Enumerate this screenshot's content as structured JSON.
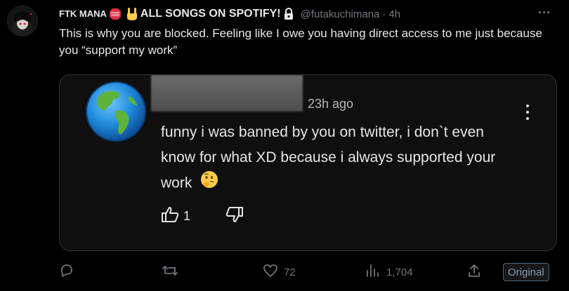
{
  "post": {
    "display_name": "FTK MANA",
    "display_name_suffix": "ALL SONGS ON SPOTIFY!",
    "handle": "@futakuchimana",
    "separator": "·",
    "time": "4h",
    "text": "This is why you are blocked. Feeling like I owe you having direct access to me just because you “support my work”"
  },
  "embedded_comment": {
    "time": "23h ago",
    "text": "funny i was banned by you on twitter, i don`t even know for what XD because i always supported your work",
    "like_count": "1"
  },
  "actions": {
    "replies": "",
    "reposts": "",
    "likes": "72",
    "views": "1,704",
    "original_label": "Original"
  },
  "colors": {
    "background": "#000000",
    "text": "#e7e9ea",
    "muted": "#71767b",
    "card_border": "#2f3336"
  },
  "icons": [
    "more-icon",
    "stop-sign-emoji",
    "rock-hand-emoji",
    "lock-icon",
    "globe-emoji",
    "kebab-icon",
    "thumbs-up-icon",
    "thumbs-down-icon",
    "thinking-emoji",
    "reply-icon",
    "repost-icon",
    "heart-icon",
    "views-icon",
    "share-icon"
  ]
}
